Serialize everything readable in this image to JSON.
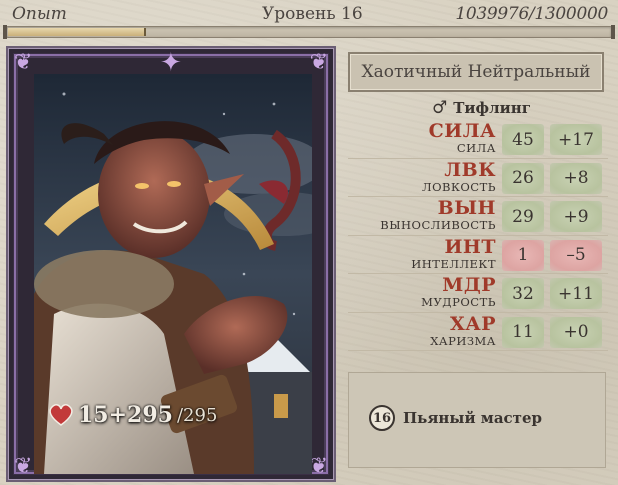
{
  "xp": {
    "label": "Опыт",
    "level_text": "Уровень 16",
    "value_text": "1039976/1300000",
    "current": 1039976,
    "max": 1300000
  },
  "character": {
    "alignment": "Хаотичный Нейтральный",
    "gender_icon": "male-icon",
    "race": "Тифлинг",
    "hp": {
      "current_text": "15+295",
      "max_text": "/295"
    }
  },
  "stats": [
    {
      "abbr": "СИЛА",
      "name": "СИЛА",
      "score": "45",
      "mod": "+17",
      "tone": "good"
    },
    {
      "abbr": "ЛВК",
      "name": "ЛОВКОСТЬ",
      "score": "26",
      "mod": "+8",
      "tone": "good"
    },
    {
      "abbr": "ВЫН",
      "name": "ВЫНОСЛИВОСТЬ",
      "score": "29",
      "mod": "+9",
      "tone": "good"
    },
    {
      "abbr": "ИНТ",
      "name": "ИНТЕЛЛЕКТ",
      "score": "1",
      "mod": "–5",
      "tone": "bad"
    },
    {
      "abbr": "МДР",
      "name": "МУДРОСТЬ",
      "score": "32",
      "mod": "+11",
      "tone": "good"
    },
    {
      "abbr": "ХАР",
      "name": "ХАРИЗМА",
      "score": "11",
      "mod": "+0",
      "tone": "good"
    }
  ],
  "feat": {
    "level": "16",
    "name": "Пьяный мастер"
  },
  "colors": {
    "stat_abbr": "#a03a2a",
    "good_box": "#bfc9a8",
    "bad_box": "#e0aaa8",
    "frame_purple": "#8b6fa8",
    "hp_heart": "#c23a3a"
  }
}
